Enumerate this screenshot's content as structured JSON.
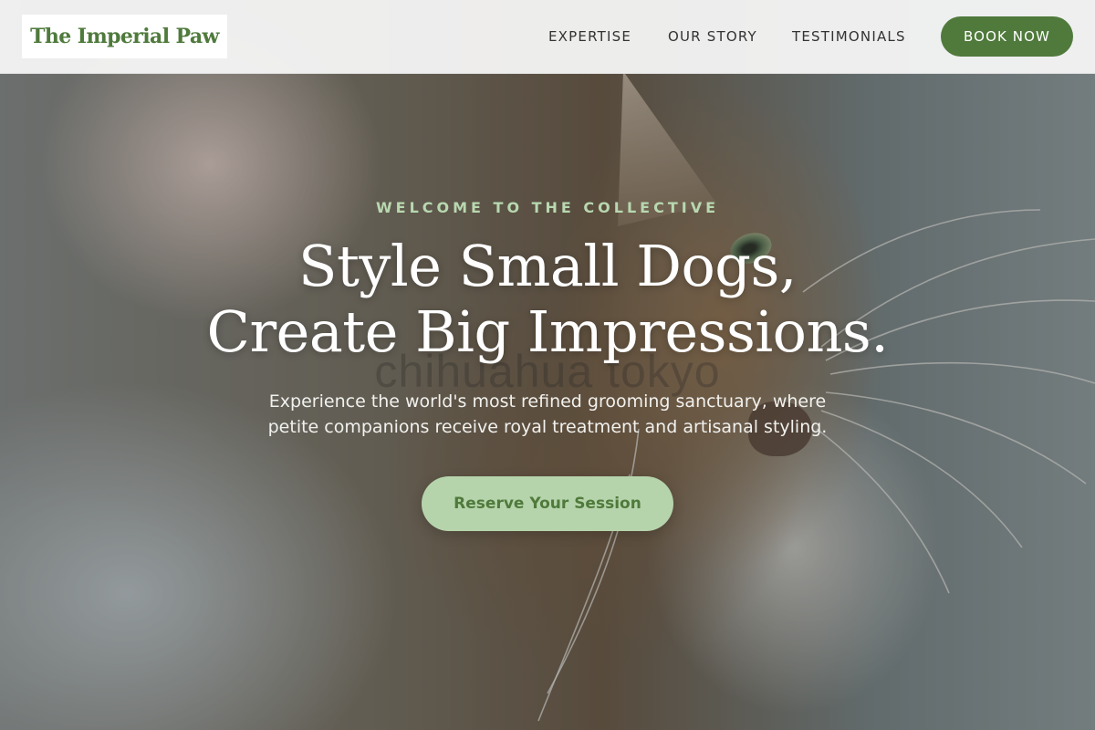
{
  "brand": {
    "name": "The Imperial Paw"
  },
  "nav": {
    "items": [
      {
        "label": "EXPERTISE"
      },
      {
        "label": "OUR STORY"
      },
      {
        "label": "TESTIMONIALS"
      }
    ],
    "book_button": "BOOK NOW"
  },
  "hero": {
    "eyebrow": "WELCOME TO THE COLLECTIVE",
    "headline_lines": [
      "Style Small Dogs,",
      "Create Big Impressions."
    ],
    "description_lines": [
      "Experience the world's most refined grooming sanctuary, where",
      "petite companions receive royal treatment and artisanal styling."
    ],
    "cta_label": "Reserve Your Session",
    "watermark": "chihuahua tokyo",
    "background_image": "tabby-cat-photo"
  },
  "colors": {
    "brand_green": "#4f7a3c",
    "cta_background": "#b6d4ab",
    "eyebrow_text": "#b8d8b0",
    "header_background": "#f5f5f5"
  }
}
